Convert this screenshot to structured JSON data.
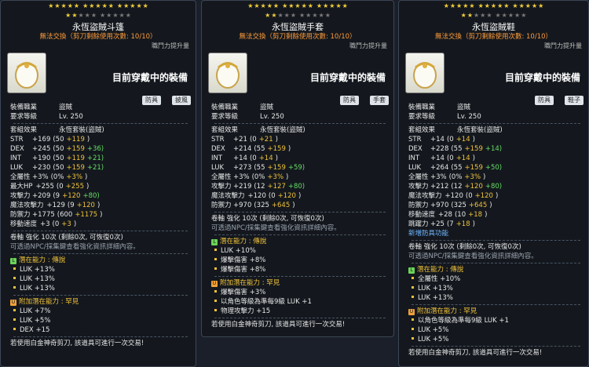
{
  "panels": [
    {
      "stars_row1": 15,
      "stars_row2_filled": 2,
      "stars_row2_total": 10,
      "title": "永恆盜賊斗篷",
      "trade": "無法交換（剪刀剩餘使用次數: 10/10）",
      "stat_hint": "職鬥力提升量",
      "equipped": "目前穿戴中的裝備",
      "tags": [
        "防具",
        "披風"
      ],
      "job_label": "裝備職業",
      "job_value": "盜賊",
      "level_label": "要求等級",
      "level_value": "Lv. 250",
      "set_label": "套組效果",
      "set_value": "永恆套裝(盜賊)",
      "stats": [
        [
          "STR",
          "+169",
          "(50",
          "+119",
          ")"
        ],
        [
          "DEX",
          "+245",
          "(50",
          "+159",
          "+36)"
        ],
        [
          "INT",
          "+190",
          "(50",
          "+119",
          "+21)"
        ],
        [
          "LUK",
          "+230",
          "(50",
          "+159",
          "+21)"
        ],
        [
          "全屬性",
          "+3%",
          "(0%",
          "+3%",
          ")"
        ],
        [
          "最大HP",
          "+255",
          "(0",
          "+255",
          ")"
        ],
        [
          "攻擊力",
          "+209",
          "(9",
          "+120",
          "+80)"
        ],
        [
          "魔法攻擊力",
          "+129",
          "(9",
          "+120",
          ")"
        ],
        [
          "防禦力",
          "+1775",
          "(600",
          "+1175",
          ")"
        ],
        [
          "移動速度",
          "+3",
          "(0",
          "+3",
          ")"
        ]
      ],
      "scroll": "卷軸 強化 10次 (剩餘0次, 可恢復0次)",
      "npc": "可透過NPC/採集鍵查看強化資訊詳細內容。",
      "pot_title": "潛在能力 : ",
      "pot_rank": "傳說",
      "pot_lines": [
        "LUK +13%",
        "LUK +13%",
        "LUK +13%"
      ],
      "add_title": "附加潛在能力 : ",
      "add_rank": "罕見",
      "add_lines": [
        "LUK +7%",
        "LUK +5%",
        "DEX +15"
      ],
      "footer": "若使用白金神奇剪刀, 該道具可進行一次交易!"
    },
    {
      "stars_row1": 15,
      "stars_row2_filled": 2,
      "stars_row2_total": 10,
      "title": "永恆盜賊手套",
      "trade": "無法交換（剪刀剩餘使用次數: 10/10）",
      "stat_hint": "職鬥力提升量",
      "equipped": "目前穿戴中的裝備",
      "tags": [
        "防具",
        "手套"
      ],
      "job_label": "裝備職業",
      "job_value": "盜賊",
      "level_label": "要求等級",
      "level_value": "Lv. 250",
      "set_label": "套組效果",
      "set_value": "永恆套裝(盜賊)",
      "stats": [
        [
          "STR",
          "+21",
          "(0",
          "+21",
          ")"
        ],
        [
          "DEX",
          "+214",
          "(55",
          "+159",
          ")"
        ],
        [
          "INT",
          "+14",
          "(0",
          "+14",
          ")"
        ],
        [
          "LUK",
          "+273",
          "(55",
          "+159",
          "+59)"
        ],
        [
          "全屬性",
          "+3%",
          "(0%",
          "+3%",
          ")"
        ],
        [
          "攻擊力",
          "+219",
          "(12",
          "+127",
          "+80)"
        ],
        [
          "魔法攻擊力",
          "+120",
          "(0",
          "+120",
          ")"
        ],
        [
          "防禦力",
          "+970",
          "(325",
          "+645",
          ")"
        ]
      ],
      "scroll": "卷軸 強化 10次 (剩餘0次, 可恢復0次)",
      "npc": "可透過NPC/採集鍵查看強化資訊詳細內容。",
      "pot_title": "潛在能力 : ",
      "pot_rank": "傳說",
      "pot_lines": [
        "LUK +10%",
        "爆擊傷害 +8%",
        "爆擊傷害 +8%"
      ],
      "add_title": "附加潛在能力 : ",
      "add_rank": "罕見",
      "add_lines": [
        "爆擊傷害 +3%",
        "以角色等級為準每9級 LUK +1",
        "物理攻擊力 +15"
      ],
      "footer": "若使用白金神奇剪刀, 該道具可進行一次交易!"
    },
    {
      "stars_row1": 15,
      "stars_row2_filled": 2,
      "stars_row2_total": 10,
      "title": "永恆盜賊鞋",
      "trade": "無法交換（剪刀剩餘使用次數: 10/10）",
      "stat_hint": "職鬥力提升量",
      "equipped": "目前穿戴中的裝備",
      "tags": [
        "防具",
        "鞋子"
      ],
      "job_label": "裝備職業",
      "job_value": "盜賊",
      "level_label": "要求等級",
      "level_value": "Lv. 250",
      "set_label": "套組效果",
      "set_value": "永恆套裝(盜賊)",
      "stats": [
        [
          "STR",
          "+14",
          "(0",
          "+14",
          ")"
        ],
        [
          "DEX",
          "+228",
          "(55",
          "+159",
          "+14)"
        ],
        [
          "INT",
          "+14",
          "(0",
          "+14",
          ")"
        ],
        [
          "LUK",
          "+264",
          "(55",
          "+159",
          "+50)"
        ],
        [
          "全屬性",
          "+3%",
          "(0%",
          "+3%",
          ")"
        ],
        [
          "攻擊力",
          "+212",
          "(12",
          "+120",
          "+80)"
        ],
        [
          "魔法攻擊力",
          "+120",
          "(0",
          "+120",
          ")"
        ],
        [
          "防禦力",
          "+970",
          "(325",
          "+645",
          ")"
        ],
        [
          "移動速度",
          "+28",
          "(10",
          "+18",
          ")"
        ],
        [
          "跳躍力",
          "+25",
          "(7",
          "+18",
          ")"
        ]
      ],
      "extra": "新增防具功能",
      "scroll": "卷軸 強化 10次 (剩餘0次, 可恢復0次)",
      "npc": "可透過NPC/採集鍵查看強化資訊詳細內容。",
      "pot_title": "潛在能力 : ",
      "pot_rank": "傳說",
      "pot_lines": [
        "全屬性 +10%",
        "LUK +13%",
        "LUK +13%"
      ],
      "add_title": "附加潛在能力 : ",
      "add_rank": "罕見",
      "add_lines": [
        "以角色等級為準每9級 LUK +1",
        "LUK +5%",
        "LUK +5%"
      ],
      "footer": "若使用白金神奇剪刀, 該道具可進行一次交易!"
    }
  ]
}
